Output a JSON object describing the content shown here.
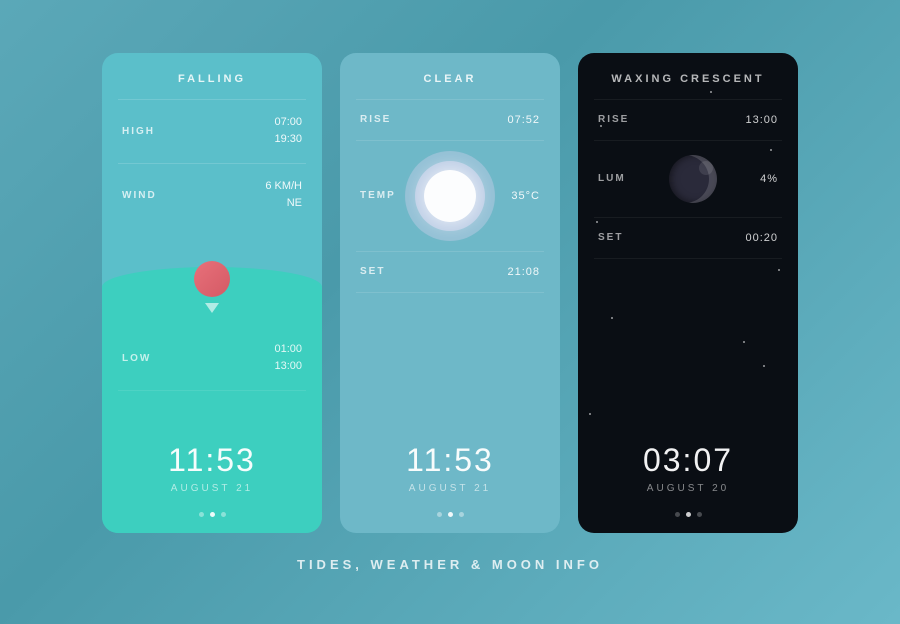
{
  "page": {
    "title": "TIDES, WEATHER & MOON INFO",
    "background": "#5ba8b8"
  },
  "tides": {
    "header": "FALLING",
    "high_label": "HIGH",
    "high_time": "07:00",
    "high_value": "19:30",
    "wind_label": "WIND",
    "wind_speed": "6 KM/H",
    "wind_dir": "NE",
    "low_label": "LOW",
    "low_time": "01:00",
    "low_value": "13:00",
    "time": "11:53",
    "date": "AUGUST 21",
    "dots": [
      false,
      true,
      false
    ]
  },
  "weather": {
    "header": "CLEAR",
    "rise_label": "RISE",
    "rise_time": "07:52",
    "temp_label": "TEMP",
    "temp_value": "35°C",
    "set_label": "SET",
    "set_time": "21:08",
    "time": "11:53",
    "date": "AUGUST 21",
    "dots": [
      false,
      true,
      false
    ]
  },
  "moon": {
    "header": "WAXING CRESCENT",
    "rise_label": "RISE",
    "rise_time": "13:00",
    "lum_label": "LUM",
    "lum_value": "4%",
    "set_label": "SET",
    "set_time": "00:20",
    "time": "03:07",
    "date": "AUGUST 20",
    "dots": [
      false,
      true,
      false
    ]
  }
}
